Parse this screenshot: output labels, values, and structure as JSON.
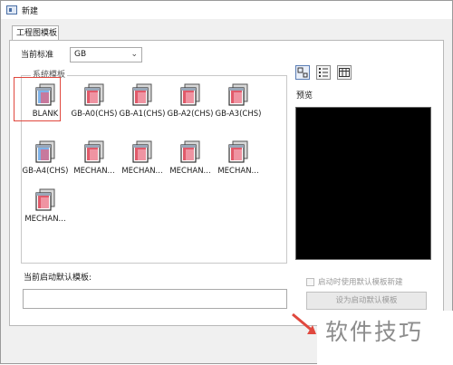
{
  "window": {
    "title": "新建"
  },
  "tabs": [
    {
      "label": "工程图模板",
      "active": true
    }
  ],
  "standard": {
    "label": "当前标准",
    "value": "GB"
  },
  "system_templates": {
    "group_label": "系统模板",
    "items": [
      {
        "label": "BLANK",
        "selected": true
      },
      {
        "label": "GB-A0(CHS)"
      },
      {
        "label": "GB-A1(CHS)"
      },
      {
        "label": "GB-A2(CHS)"
      },
      {
        "label": "GB-A3(CHS)"
      },
      {
        "label": "GB-A4(CHS)"
      },
      {
        "label": "MECHAN..."
      },
      {
        "label": "MECHAN..."
      },
      {
        "label": "MECHAN..."
      },
      {
        "label": "MECHAN..."
      },
      {
        "label": "MECHAN..."
      }
    ]
  },
  "view_modes": [
    "large-icons-view-icon",
    "list-view-icon",
    "details-view-icon"
  ],
  "preview": {
    "label": "预览"
  },
  "default_template": {
    "label": "当前启动默认模板:",
    "value": ""
  },
  "startup_option": {
    "label": "启动时使用默认模板新建",
    "checked": false
  },
  "set_default_button": {
    "label": "设为启动默认模板"
  },
  "watermark": {
    "text": "软件技巧"
  },
  "colors": {
    "selection": "#e0483e",
    "preview_bg": "#000000"
  }
}
